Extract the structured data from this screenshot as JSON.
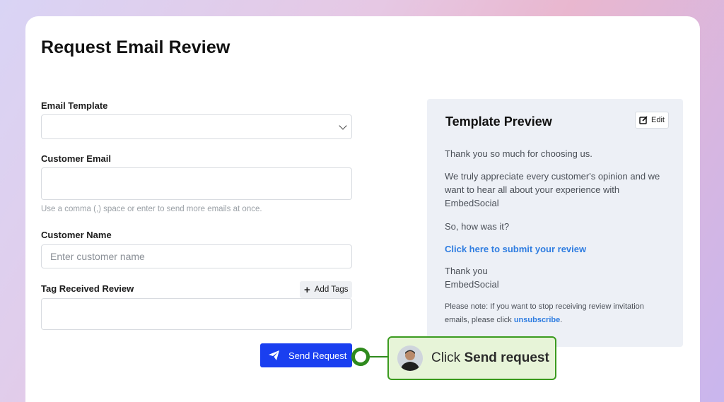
{
  "page": {
    "title": "Request Email Review"
  },
  "form": {
    "email_template": {
      "label": "Email Template",
      "value": ""
    },
    "customer_email": {
      "label": "Customer Email",
      "value": "",
      "hint": "Use a comma (,) space or enter to send more emails at once."
    },
    "customer_name": {
      "label": "Customer Name",
      "placeholder": "Enter customer name",
      "value": ""
    },
    "tags": {
      "label": "Tag Received Review",
      "add_label": "Add Tags",
      "value": ""
    },
    "send_label": "Send Request"
  },
  "preview": {
    "title": "Template Preview",
    "edit_label": "Edit",
    "line1": "Thank you so much for choosing us.",
    "para2_line1": "We truly appreciate every customer's opinion and we",
    "para2_line2": "want to hear all about your experience with",
    "para2_line3": "EmbedSocial",
    "line3": "So, how was it?",
    "link": "Click here to submit your review",
    "signoff1": "Thank you",
    "signoff2": "EmbedSocial",
    "note_line1": "Please note: If you want to stop receiving review invitation",
    "note_line2": "emails, please click",
    "note_link": "unsubscribe",
    "note_end": "."
  },
  "callout": {
    "prefix": "Click",
    "bold": "Send request"
  },
  "colors": {
    "accent": "#1a3ff0",
    "link": "#2f7de1",
    "callout_bg": "#e7f4d8",
    "callout_border": "#3b9b1f"
  },
  "icons": {
    "select_caret": "chevron-down-icon",
    "add": "plus-icon",
    "send": "paper-plane-icon",
    "edit": "edit-icon"
  }
}
